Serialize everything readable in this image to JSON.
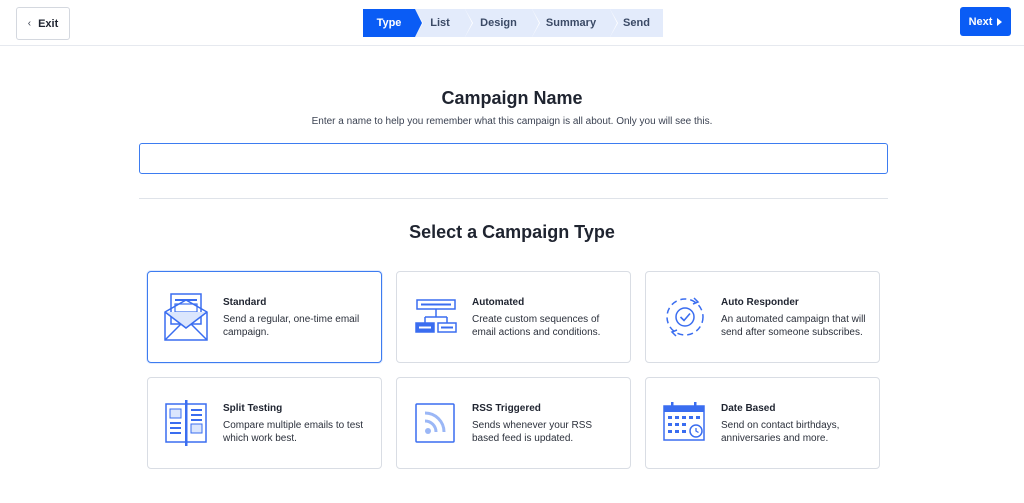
{
  "header": {
    "exit_chevron": "‹",
    "exit_label": "Exit",
    "next_label": "Next",
    "steps": [
      {
        "label": "Type",
        "active": true
      },
      {
        "label": "List",
        "active": false
      },
      {
        "label": "Design",
        "active": false
      },
      {
        "label": "Summary",
        "active": false
      },
      {
        "label": "Send",
        "active": false
      }
    ]
  },
  "name_section": {
    "title": "Campaign Name",
    "subtitle": "Enter a name to help you remember what this campaign is all about. Only you will see this.",
    "input_value": "",
    "input_placeholder": ""
  },
  "type_section": {
    "title": "Select a Campaign Type",
    "cards": [
      {
        "title": "Standard",
        "description": "Send a regular, one-time email campaign.",
        "icon": "envelope-icon",
        "selected": true
      },
      {
        "title": "Automated",
        "description": "Create custom sequences of email actions and conditions.",
        "icon": "workflow-icon",
        "selected": false
      },
      {
        "title": "Auto Responder",
        "description": "An automated campaign that will send after someone subscribes.",
        "icon": "cycle-check-icon",
        "selected": false
      },
      {
        "title": "Split Testing",
        "description": "Compare multiple emails to test which work best.",
        "icon": "split-layout-icon",
        "selected": false
      },
      {
        "title": "RSS Triggered",
        "description": "Sends whenever your RSS based feed is updated.",
        "icon": "rss-icon",
        "selected": false
      },
      {
        "title": "Date Based",
        "description": "Send on contact birthdays, anniversaries and more.",
        "icon": "calendar-icon",
        "selected": false
      }
    ]
  },
  "colors": {
    "accent": "#0a5cf5",
    "step_inactive": "#e3ebfb",
    "icon_blue": "#3a6df0"
  }
}
